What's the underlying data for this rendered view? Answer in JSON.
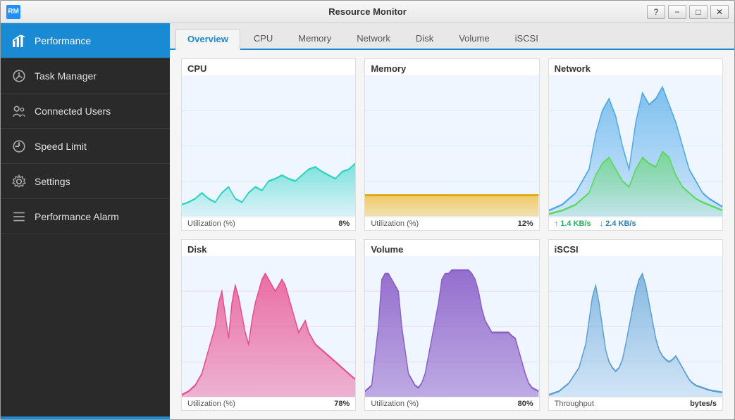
{
  "window": {
    "title": "Resource Monitor",
    "icon": "RM"
  },
  "titlebar": {
    "controls": {
      "help": "?",
      "minimize": "−",
      "maximize": "□",
      "close": "✕"
    }
  },
  "sidebar": {
    "items": [
      {
        "id": "performance",
        "label": "Performance",
        "icon": "📊",
        "active": true
      },
      {
        "id": "task-manager",
        "label": "Task Manager",
        "icon": "⚙"
      },
      {
        "id": "connected-users",
        "label": "Connected Users",
        "icon": "🔧"
      },
      {
        "id": "speed-limit",
        "label": "Speed Limit",
        "icon": "⚙"
      },
      {
        "id": "settings",
        "label": "Settings",
        "icon": "⚙"
      },
      {
        "id": "performance-alarm",
        "label": "Performance Alarm",
        "icon": "☰"
      }
    ]
  },
  "tabs": [
    {
      "id": "overview",
      "label": "Overview",
      "active": true
    },
    {
      "id": "cpu",
      "label": "CPU"
    },
    {
      "id": "memory",
      "label": "Memory"
    },
    {
      "id": "network",
      "label": "Network"
    },
    {
      "id": "disk",
      "label": "Disk"
    },
    {
      "id": "volume",
      "label": "Volume"
    },
    {
      "id": "iscsi",
      "label": "iSCSI"
    }
  ],
  "charts": {
    "cpu": {
      "title": "CPU",
      "footer_label": "Utilization (%)",
      "footer_value": "8%",
      "color": "#2dd4c4"
    },
    "memory": {
      "title": "Memory",
      "footer_label": "Utilization (%)",
      "footer_value": "12%",
      "color": "#f0c040"
    },
    "network": {
      "title": "Network",
      "up_label": "↑ 1.4 KB/s",
      "down_label": "↓ 2.4 KB/s"
    },
    "disk": {
      "title": "Disk",
      "footer_label": "Utilization (%)",
      "footer_value": "78%",
      "color": "#e84c8e"
    },
    "volume": {
      "title": "Volume",
      "footer_label": "Utilization (%)",
      "footer_value": "80%",
      "color": "#8b5fc8"
    },
    "iscsi": {
      "title": "iSCSI",
      "footer_label": "Throughput",
      "footer_value": "bytes/s"
    }
  }
}
